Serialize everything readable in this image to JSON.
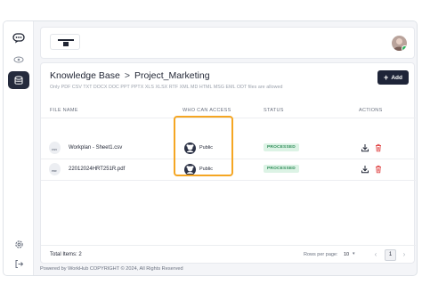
{
  "breadcrumb": {
    "root": "Knowledge Base",
    "separator": ">",
    "current": "Project_Marketing"
  },
  "allowed_files": "Only PDF CSV TXT DOCX DOC PPT PPTX XLS XLSX RTF XML MD HTML MSG EML ODT files are allowed",
  "add_button": {
    "icon": "+",
    "label": "Add"
  },
  "table": {
    "headers": [
      "FILE NAME",
      "WHO CAN ACCESS",
      "STATUS",
      "ACTIONS"
    ],
    "rows": [
      {
        "file_type": "CSV",
        "file_name": "Workplan - Sheet1.csv",
        "access": "Public",
        "status": "PROCESSED"
      },
      {
        "file_type": "PDF",
        "file_name": "22012024HRT251R.pdf",
        "access": "Public",
        "status": "PROCESSED"
      }
    ]
  },
  "footer": {
    "total_items": "Total Items: 2",
    "rows_per_page_label": "Rows per page:",
    "rows_per_page": "10",
    "current_page": "1"
  },
  "copyright": "Powered by WorkHub COPYRIGHT © 2024, All Rights Reserved",
  "colors": {
    "accent": "#1e2438",
    "highlight": "#f5a623",
    "status_bg": "#dcf3e5",
    "status_fg": "#2e8b57",
    "delete": "#e14b4b"
  },
  "icons": [
    "chat-bubble-icon",
    "eye-icon",
    "database-icon",
    "settings-icon",
    "logout-icon",
    "download-icon",
    "trash-icon",
    "user-group-icon",
    "file-icon"
  ]
}
